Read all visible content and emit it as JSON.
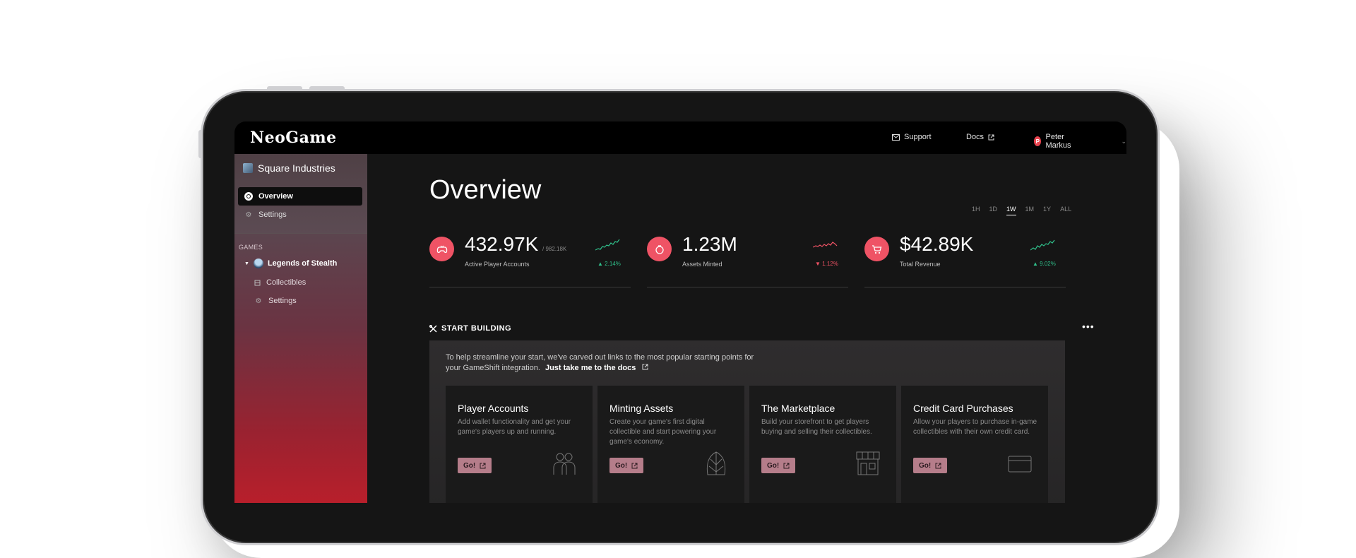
{
  "app": {
    "logo": "NeoGame"
  },
  "topbar": {
    "support": "Support",
    "docs": "Docs",
    "user": {
      "initial": "P",
      "name": "Peter Markus"
    }
  },
  "sidebar": {
    "org_name": "Square Industries",
    "items": [
      {
        "label": "Overview",
        "active": true
      },
      {
        "label": "Settings"
      }
    ],
    "games_label": "GAMES",
    "game": {
      "name": "Legends of Stealth",
      "children": [
        {
          "label": "Collectibles"
        },
        {
          "label": "Settings"
        }
      ]
    }
  },
  "main": {
    "title": "Overview",
    "ranges": [
      "1H",
      "1D",
      "1W",
      "1M",
      "1Y",
      "ALL"
    ],
    "selected_range": "1W",
    "stats": [
      {
        "value": "432.97K",
        "sub": "/ 982.18K",
        "label": "Active Player Accounts",
        "delta": "2.14%",
        "trend": "up",
        "icon": "controller-icon"
      },
      {
        "value": "1.23M",
        "sub": "",
        "label": "Assets Minted",
        "delta": "1.12%",
        "trend": "down",
        "icon": "mint-icon"
      },
      {
        "value": "$42.89K",
        "sub": "",
        "label": "Total Revenue",
        "delta": "9.02%",
        "trend": "up",
        "icon": "cart-icon"
      }
    ],
    "start_building": {
      "heading": "START BUILDING",
      "intro": "To help streamline your start, we've carved out links to the most popular starting points for your GameShift integration.",
      "docs_link": "Just take me to the docs",
      "cards": [
        {
          "title": "Player Accounts",
          "desc": "Add wallet functionality and get your game's players up and running.",
          "button": "Go!",
          "icon": "people-icon"
        },
        {
          "title": "Minting Assets",
          "desc": "Create your game's first digital collectible and start powering your game's economy.",
          "button": "Go!",
          "icon": "leaf-icon"
        },
        {
          "title": "The Marketplace",
          "desc": "Build your storefront to get players buying and selling their collectibles.",
          "button": "Go!",
          "icon": "store-icon"
        },
        {
          "title": "Credit Card Purchases",
          "desc": "Allow your players to purchase in-game collectibles with their own credit card.",
          "button": "Go!",
          "icon": "credit-card-icon"
        }
      ]
    }
  },
  "colors": {
    "accent": "#ef5365",
    "up": "#2fbf8a",
    "down": "#ef5365",
    "button": "#b57d8a"
  }
}
